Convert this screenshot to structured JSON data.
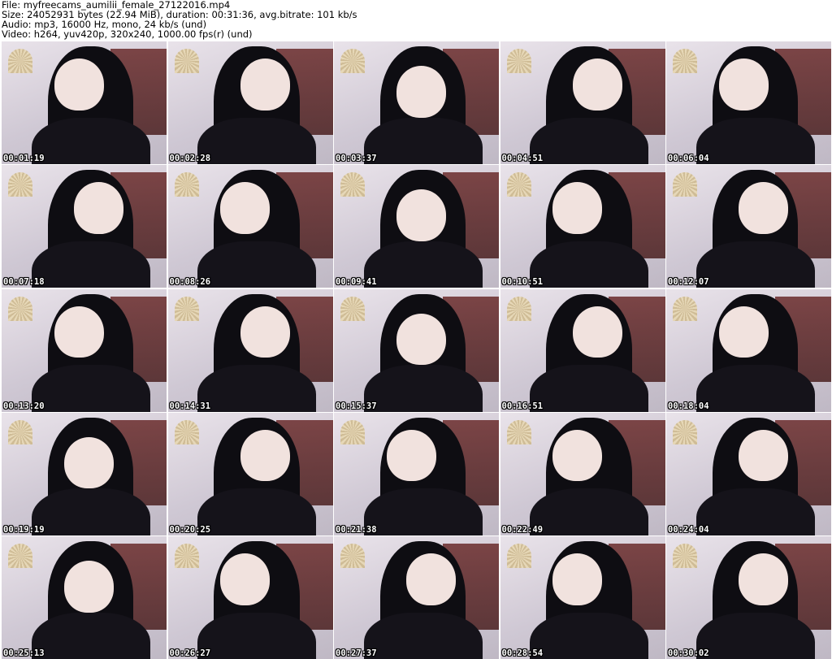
{
  "header": {
    "file_line": "File: myfreecams_aumilii_female_27122016.mp4",
    "size_line": "Size: 24052931 bytes (22.94 MiB), duration: 00:31:36, avg.bitrate: 101 kb/s",
    "audio_line": "Audio: mp3, 16000 Hz, mono, 24 kb/s (und)",
    "video_line": "Video: h264, yuv420p, 320x240, 1000.00 fps(r) (und)"
  },
  "thumbnails": [
    {
      "timestamp": "00:01:19"
    },
    {
      "timestamp": "00:02:28"
    },
    {
      "timestamp": "00:03:37"
    },
    {
      "timestamp": "00:04:51"
    },
    {
      "timestamp": "00:06:04"
    },
    {
      "timestamp": "00:07:18"
    },
    {
      "timestamp": "00:08:26"
    },
    {
      "timestamp": "00:09:41"
    },
    {
      "timestamp": "00:10:51"
    },
    {
      "timestamp": "00:12:07"
    },
    {
      "timestamp": "00:13:20"
    },
    {
      "timestamp": "00:14:31"
    },
    {
      "timestamp": "00:15:37"
    },
    {
      "timestamp": "00:16:51"
    },
    {
      "timestamp": "00:18:04"
    },
    {
      "timestamp": "00:19:19"
    },
    {
      "timestamp": "00:20:25"
    },
    {
      "timestamp": "00:21:38"
    },
    {
      "timestamp": "00:22:49"
    },
    {
      "timestamp": "00:24:04"
    },
    {
      "timestamp": "00:25:13"
    },
    {
      "timestamp": "00:26:27"
    },
    {
      "timestamp": "00:27:37"
    },
    {
      "timestamp": "00:28:54"
    },
    {
      "timestamp": "00:30:02"
    }
  ]
}
